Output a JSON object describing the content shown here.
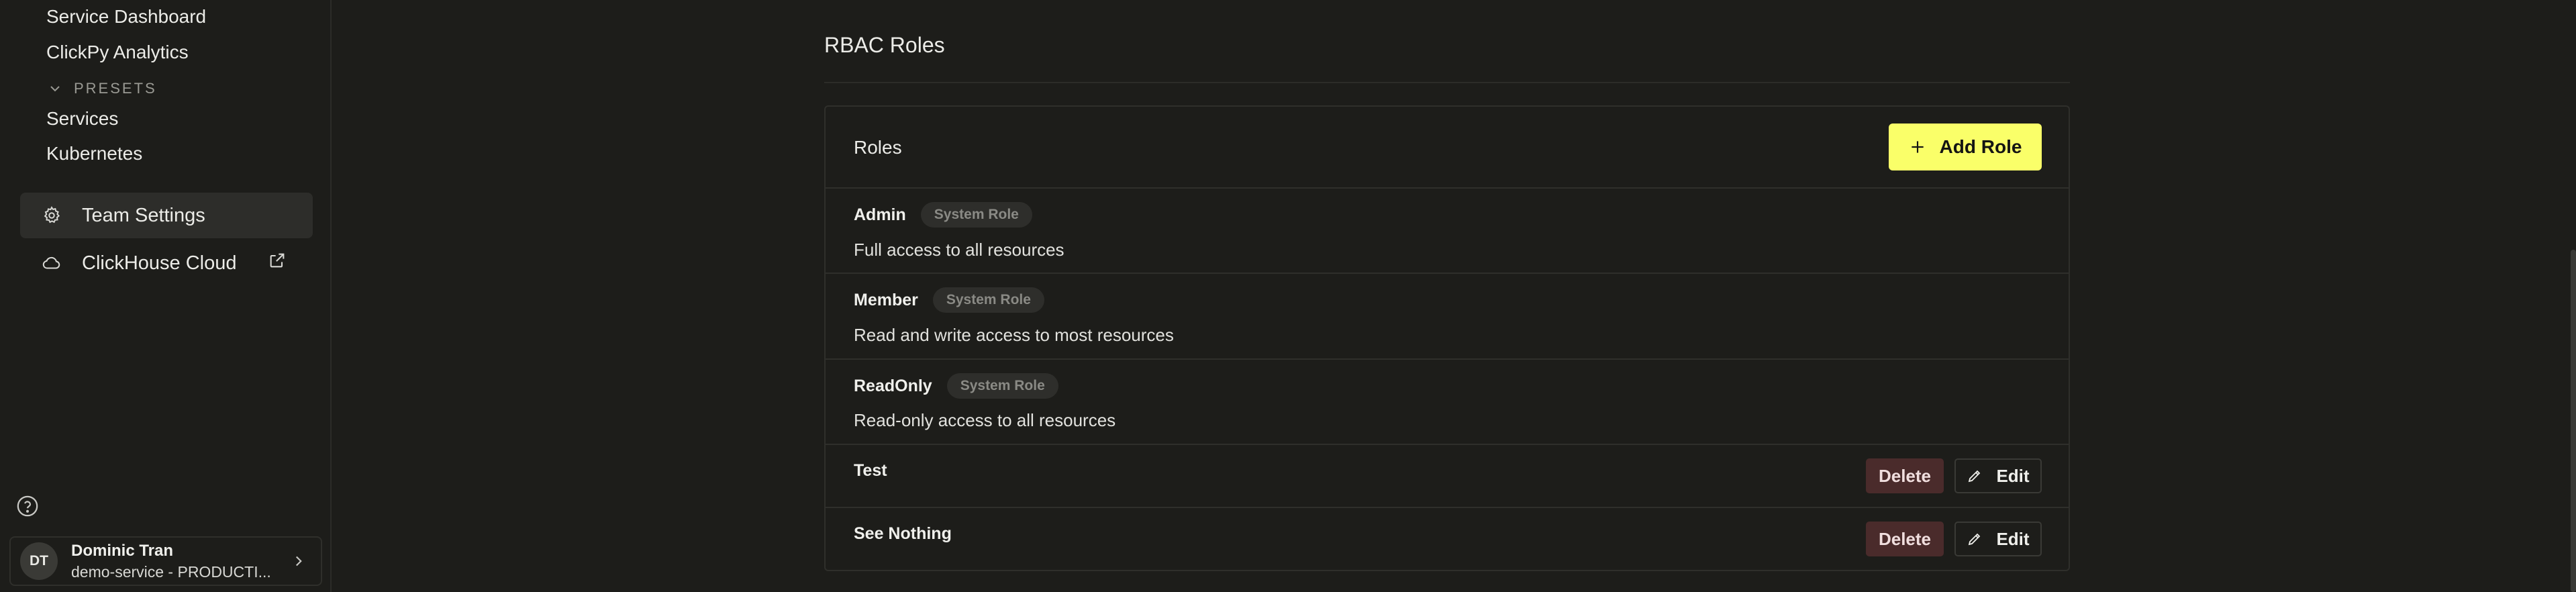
{
  "sidebar": {
    "links": {
      "service_dashboard": "Service Dashboard",
      "clickpy_analytics": "ClickPy Analytics",
      "services": "Services",
      "kubernetes": "Kubernetes"
    },
    "presets_label": "PRESETS",
    "team_settings": "Team Settings",
    "clickhouse_cloud": "ClickHouse Cloud",
    "user": {
      "initials": "DT",
      "name": "Dominic Tran",
      "service": "demo-service - PRODUCTI..."
    }
  },
  "main": {
    "title": "RBAC Roles",
    "panel_title": "Roles",
    "add_role_label": "Add Role",
    "system_badge": "System Role",
    "delete_label": "Delete",
    "edit_label": "Edit",
    "roles": [
      {
        "name": "Admin",
        "description": "Full access to all resources",
        "system": true
      },
      {
        "name": "Member",
        "description": "Read and write access to most resources",
        "system": true
      },
      {
        "name": "ReadOnly",
        "description": "Read-only access to all resources",
        "system": true
      },
      {
        "name": "Test",
        "description": "",
        "system": false
      },
      {
        "name": "See Nothing",
        "description": "",
        "system": false
      }
    ]
  },
  "colors": {
    "background": "#1d1d1a",
    "accent": "#faff69",
    "delete_bg": "#4a2b2b"
  }
}
